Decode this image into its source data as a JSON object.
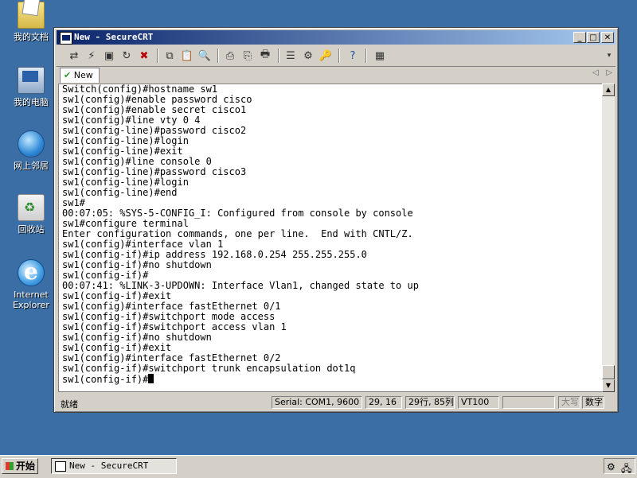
{
  "desktop": {
    "icons": [
      {
        "label": "我的文档",
        "icon": "my-documents-icon"
      },
      {
        "label": "我的电脑",
        "icon": "my-computer-icon"
      },
      {
        "label": "网上邻居",
        "icon": "network-places-icon"
      },
      {
        "label": "回收站",
        "icon": "recycle-bin-icon"
      },
      {
        "label": "Internet Explorer",
        "icon": "internet-explorer-icon"
      }
    ]
  },
  "window": {
    "title": "New - SecureCRT",
    "tab_label": "New"
  },
  "terminal": {
    "lines": [
      "Switch(config)#hostname sw1",
      "sw1(config)#enable password cisco",
      "sw1(config)#enable secret cisco1",
      "sw1(config)#line vty 0 4",
      "sw1(config-line)#password cisco2",
      "sw1(config-line)#login",
      "sw1(config-line)#exit",
      "sw1(config)#line console 0",
      "sw1(config-line)#password cisco3",
      "sw1(config-line)#login",
      "sw1(config-line)#end",
      "sw1#",
      "00:07:05: %SYS-5-CONFIG_I: Configured from console by console",
      "sw1#configure terminal",
      "Enter configuration commands, one per line.  End with CNTL/Z.",
      "sw1(config)#interface vlan 1",
      "sw1(config-if)#ip address 192.168.0.254 255.255.255.0",
      "sw1(config-if)#no shutdown",
      "sw1(config-if)#",
      "00:07:41: %LINK-3-UPDOWN: Interface Vlan1, changed state to up",
      "sw1(config-if)#exit",
      "sw1(config)#interface fastEthernet 0/1",
      "sw1(config-if)#switchport mode access",
      "sw1(config-if)#switchport access vlan 1",
      "sw1(config-if)#no shutdown",
      "sw1(config-if)#exit",
      "sw1(config)#interface fastEthernet 0/2",
      "sw1(config-if)#switchport trunk encapsulation dot1q"
    ],
    "prompt": "sw1(config-if)#"
  },
  "status": {
    "ready": "就绪",
    "serial": "Serial: COM1, 9600",
    "cursor_pos": "29, 16",
    "rows_cols": "29行, 85列",
    "terminal_type": "VT100",
    "caps": "大写",
    "num": "数字"
  },
  "taskbar": {
    "start_label": "开始",
    "task_label": "New - SecureCRT"
  }
}
